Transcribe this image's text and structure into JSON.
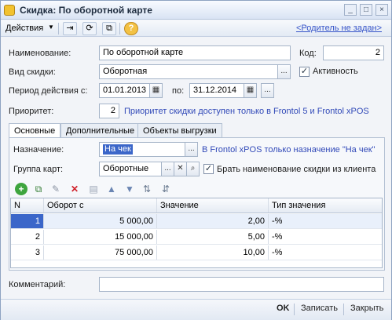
{
  "window": {
    "title": "Скидка: По оборотной карте",
    "buttons": {
      "minimize": "_",
      "restore": "□",
      "close": "×"
    }
  },
  "toolbar": {
    "actions_label": "Действия",
    "parent_link": "<Родитель не задан>",
    "icons": [
      "move-icon",
      "refresh-icon",
      "copy-icon",
      "help-icon"
    ]
  },
  "form": {
    "name_label": "Наименование:",
    "name_value": "По оборотной карте",
    "code_label": "Код:",
    "code_value": "2",
    "kind_label": "Вид скидки:",
    "kind_value": "Оборотная",
    "active_label": "Активность",
    "active_checked": true,
    "period_label": "Период действия с:",
    "period_from": "01.01.2013",
    "period_to_label": "по:",
    "period_to": "31.12.2014",
    "priority_label": "Приоритет:",
    "priority_value": "2",
    "priority_note": "Приоритет скидки доступен только в Frontol 5 и Frontol xPOS"
  },
  "tabs": [
    {
      "label": "Основные",
      "active": true
    },
    {
      "label": "Дополнительные",
      "active": false
    },
    {
      "label": "Объекты выгрузки",
      "active": false
    }
  ],
  "main_tab": {
    "purpose_label": "Назначение:",
    "purpose_value": "На чек",
    "purpose_note": "В Frontol xPOS только назначение \"На чек\"",
    "card_group_label": "Группа карт:",
    "card_group_value": "Оборотные",
    "take_name_label": "Брать наименование скидки из клиента",
    "take_name_checked": true
  },
  "table": {
    "columns": [
      "N",
      "Оборот с",
      "Значение",
      "Тип значения"
    ],
    "rows": [
      {
        "n": "1",
        "turnover": "5 000,00",
        "value": "2,00",
        "type": "-%"
      },
      {
        "n": "2",
        "turnover": "15 000,00",
        "value": "5,00",
        "type": "-%"
      },
      {
        "n": "3",
        "turnover": "75 000,00",
        "value": "10,00",
        "type": "-%"
      }
    ]
  },
  "comment_label": "Комментарий:",
  "comment_value": "",
  "footer": {
    "ok": "OK",
    "save": "Записать",
    "close": "Закрыть"
  },
  "colors": {
    "accent": "#3149b8",
    "selection": "#3b66c9",
    "title_icon": "#f2c230"
  }
}
